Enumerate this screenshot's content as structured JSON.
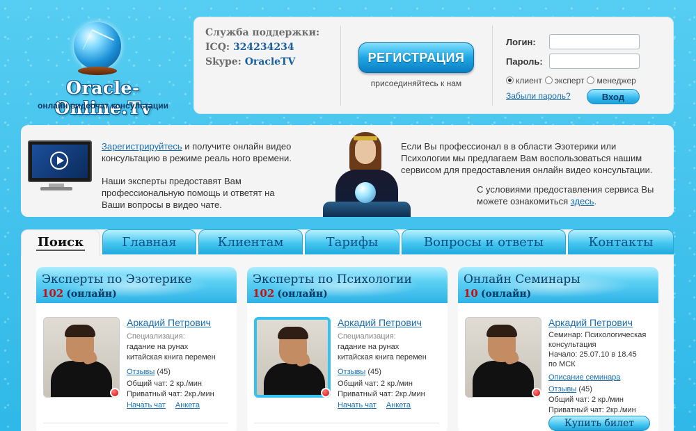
{
  "logo": {
    "title": "Oracle-Online.Tv",
    "subtitle": "онлайн видеочат консультации"
  },
  "support": {
    "heading": "Служба поддержки:",
    "icq_label": "ICQ:",
    "icq_value": "324234234",
    "skype_label": "Skype:",
    "skype_value": "OracleTV"
  },
  "register": {
    "button": "РЕГИСТРАЦИЯ",
    "note": "присоединяйтесь к нам"
  },
  "login": {
    "login_label": "Логин:",
    "password_label": "Пароль:",
    "roles": [
      "клиент",
      "эксперт",
      "менеджер"
    ],
    "selected_role": "клиент",
    "forgot": "Забыли пароль?",
    "submit": "Вход"
  },
  "info": {
    "register_link": "Зарегистрируйтесь",
    "p1_rest": " и получите онлайн видео консультацию в режиме реаль ного времени.",
    "p2": "Наши эксперты предоставят Вам профессиональную помощь и ответят на Ваши вопросы в видео чате.",
    "p3": "Если Вы профессионал в в области Эзотерики или Психологии мы предлагаем Вам воспользоваться нашим сервисом для предоставления онлайн видео консультации.",
    "p4_pre": "С условиями предоставления сервиса Вы можете ознакомиться ",
    "p4_link": "здесь",
    "p4_post": "."
  },
  "tabs": [
    {
      "label": "Поиск",
      "active": true
    },
    {
      "label": "Главная",
      "active": false
    },
    {
      "label": "Клиентам",
      "active": false
    },
    {
      "label": "Тарифы",
      "active": false
    },
    {
      "label": "Вопросы и ответы",
      "active": false
    },
    {
      "label": "Контакты",
      "active": false
    }
  ],
  "columns": [
    {
      "title": "Эксперты по Эзотерике",
      "count": "102",
      "online": "(онлайн)",
      "expert": {
        "name": "Аркадий Петрович",
        "spec_label": "Специализация:",
        "spec_lines": [
          "гадание на рунах",
          "китайская книга перемен"
        ],
        "reviews": "Отзывы",
        "reviews_count": "(45)",
        "general_chat": "Общий чат: 2 кр./мин",
        "private_chat": "Приватный чат: 2кр./мин",
        "start_chat": "Начать чат",
        "profile": "Анкета"
      }
    },
    {
      "title": "Эксперты по Психологии",
      "count": "102",
      "online": "(онлайн)",
      "expert": {
        "name": "Аркадий Петрович",
        "spec_label": "Специализация:",
        "spec_lines": [
          "гадание на рунах",
          "китайская книга перемен"
        ],
        "reviews": "Отзывы",
        "reviews_count": "(45)",
        "general_chat": "Общий чат: 2 кр./мин",
        "private_chat": "Приватный чат: 2кр./мин",
        "start_chat": "Начать чат",
        "profile": "Анкета"
      }
    },
    {
      "title": "Онлайн Семинары",
      "count": "10",
      "online": "(онлайн)",
      "expert": {
        "name": "Аркадий Петрович",
        "seminar_lines": [
          "Семинар: Психологическая",
          "консультация"
        ],
        "start_lines": [
          "Начало: 25.07.10 в 18.45",
          "по МСК"
        ],
        "description": "Описание семинара",
        "reviews": "Отзывы",
        "reviews_count": "(45)",
        "general_chat": "Общий чат: 2 кр./мин",
        "private_chat": "Приватный чат: 2кр./мин",
        "buy": "Купить билет"
      }
    }
  ],
  "colors": {
    "background": "#3fc3ee",
    "link": "#1a6fb0",
    "count_red": "#c41010"
  }
}
